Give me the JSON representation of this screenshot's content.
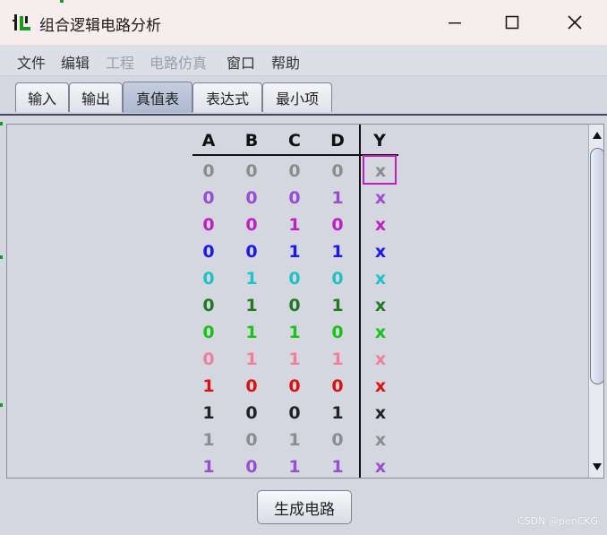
{
  "window": {
    "title": "组合逻辑电路分析",
    "minimize_icon": "minimize-icon",
    "maximize_icon": "maximize-icon",
    "close_icon": "close-icon"
  },
  "menu": [
    {
      "label": "文件",
      "enabled": true
    },
    {
      "label": "编辑",
      "enabled": true
    },
    {
      "label": "工程",
      "enabled": false
    },
    {
      "label": "电路仿真",
      "enabled": false
    },
    {
      "label": "窗口",
      "enabled": true
    },
    {
      "label": "帮助",
      "enabled": true
    }
  ],
  "tabs": [
    {
      "label": "输入",
      "active": false
    },
    {
      "label": "输出",
      "active": false
    },
    {
      "label": "真值表",
      "active": true
    },
    {
      "label": "表达式",
      "active": false
    },
    {
      "label": "最小项",
      "active": false
    }
  ],
  "truth_table": {
    "headers": [
      "A",
      "B",
      "C",
      "D",
      "Y"
    ],
    "rows": [
      {
        "values": [
          "0",
          "0",
          "0",
          "0",
          "x"
        ],
        "color": "#8c8c8c"
      },
      {
        "values": [
          "0",
          "0",
          "0",
          "1",
          "x"
        ],
        "color": "#9a4dcc"
      },
      {
        "values": [
          "0",
          "0",
          "1",
          "0",
          "x"
        ],
        "color": "#c21fc2"
      },
      {
        "values": [
          "0",
          "0",
          "1",
          "1",
          "x"
        ],
        "color": "#1a1ae6"
      },
      {
        "values": [
          "0",
          "1",
          "0",
          "0",
          "x"
        ],
        "color": "#1cc2c8"
      },
      {
        "values": [
          "0",
          "1",
          "0",
          "1",
          "x"
        ],
        "color": "#1f7a1f"
      },
      {
        "values": [
          "0",
          "1",
          "1",
          "0",
          "x"
        ],
        "color": "#16c416"
      },
      {
        "values": [
          "0",
          "1",
          "1",
          "1",
          "x"
        ],
        "color": "#f0809a"
      },
      {
        "values": [
          "1",
          "0",
          "0",
          "0",
          "x"
        ],
        "color": "#e01010"
      },
      {
        "values": [
          "1",
          "0",
          "0",
          "1",
          "x"
        ],
        "color": "#222222"
      },
      {
        "values": [
          "1",
          "0",
          "1",
          "0",
          "x"
        ],
        "color": "#8c8c8c"
      },
      {
        "values": [
          "1",
          "0",
          "1",
          "1",
          "x"
        ],
        "color": "#9a4dcc"
      }
    ],
    "selected_row": 0
  },
  "generate_button": "生成电路",
  "watermark": "CSDN @penCKG"
}
